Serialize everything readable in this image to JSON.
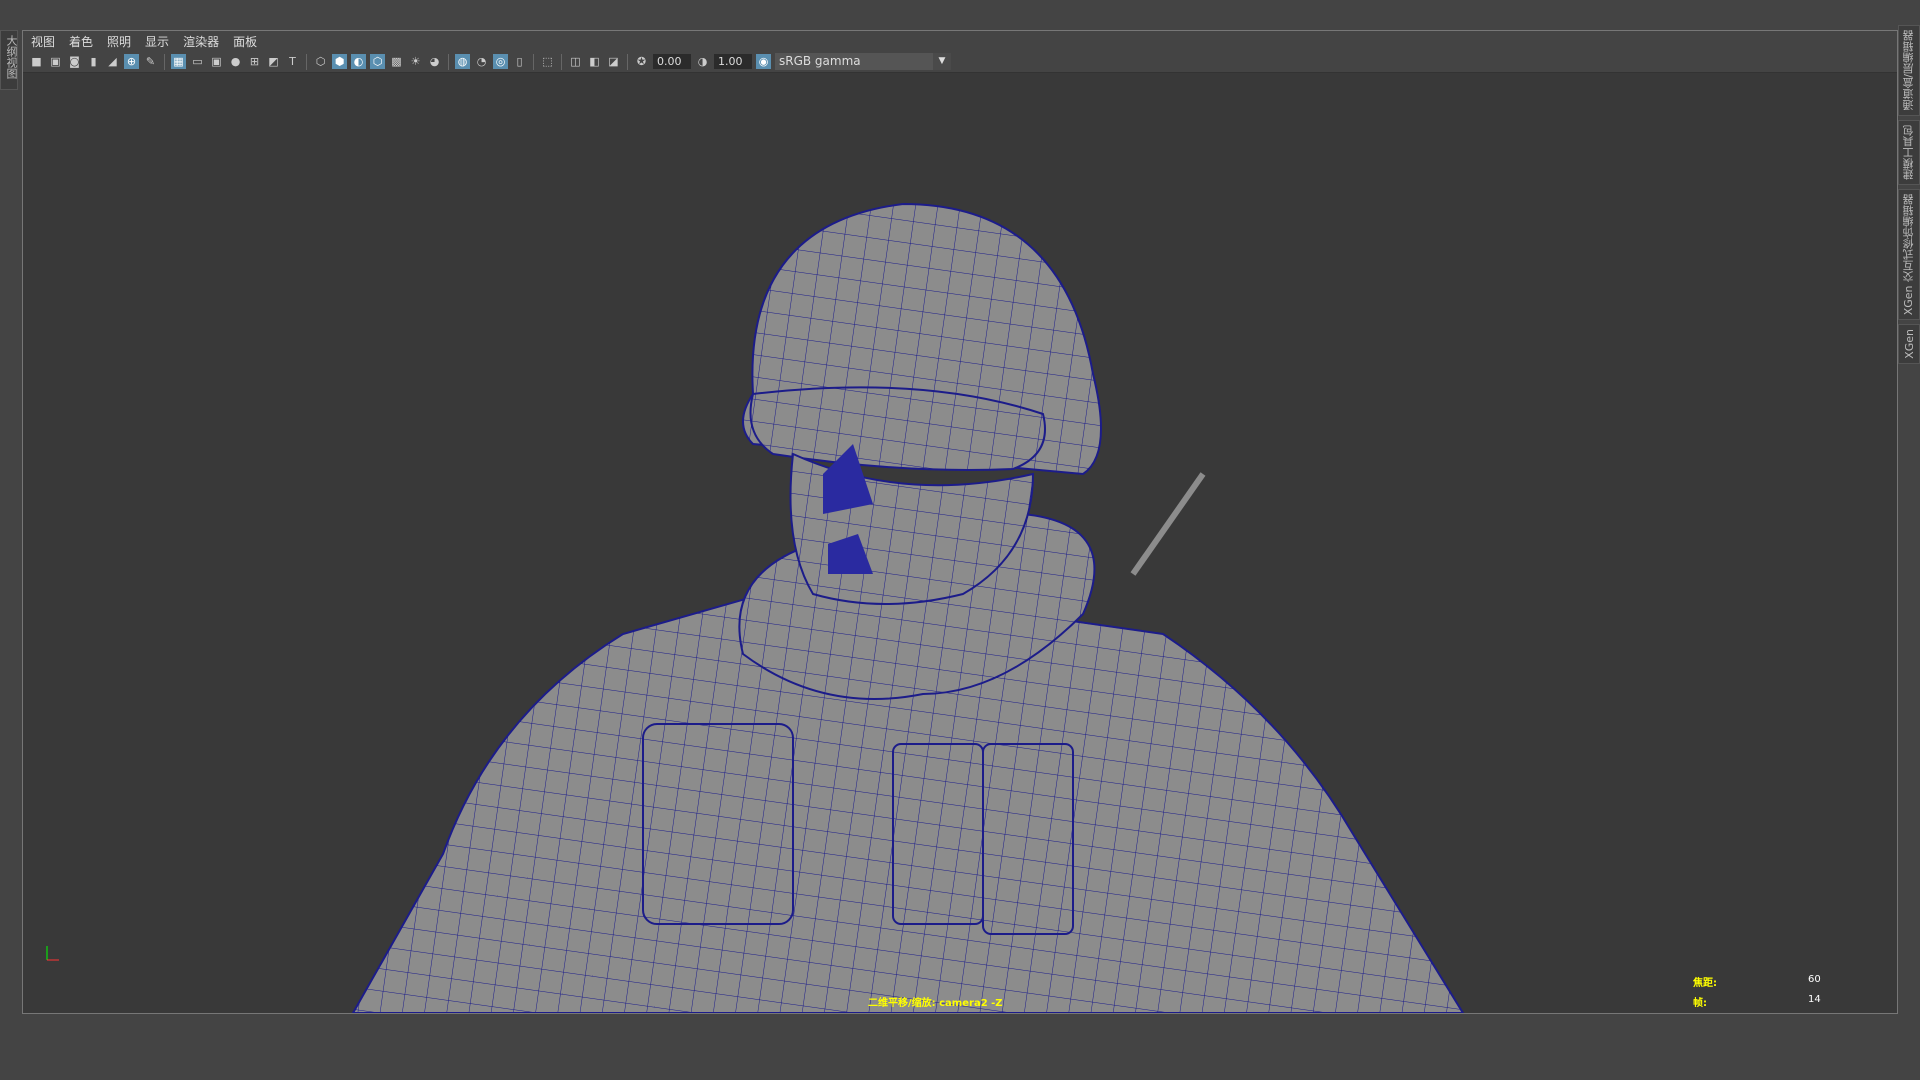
{
  "left_tab": "大纲视图",
  "right_tabs": [
    "通道盒/层编辑器",
    "建模工具包",
    "XGen 交互式修饰编辑器",
    "XGen"
  ],
  "menu": [
    "视图",
    "着色",
    "照明",
    "显示",
    "渲染器",
    "面板"
  ],
  "toolbar": {
    "exposure": "0.00",
    "gamma": "1.00",
    "color_space": "sRGB gamma"
  },
  "hud": {
    "camera_label": "二维平移/缩放: camera2 -Z",
    "focal_label": "焦距:",
    "focal_value": "60",
    "frame_label": "帧:",
    "frame_value": "14"
  },
  "colors": {
    "wire": "#1c1c8a",
    "mesh": "#8c8c8c",
    "hud": "#ffff00"
  }
}
